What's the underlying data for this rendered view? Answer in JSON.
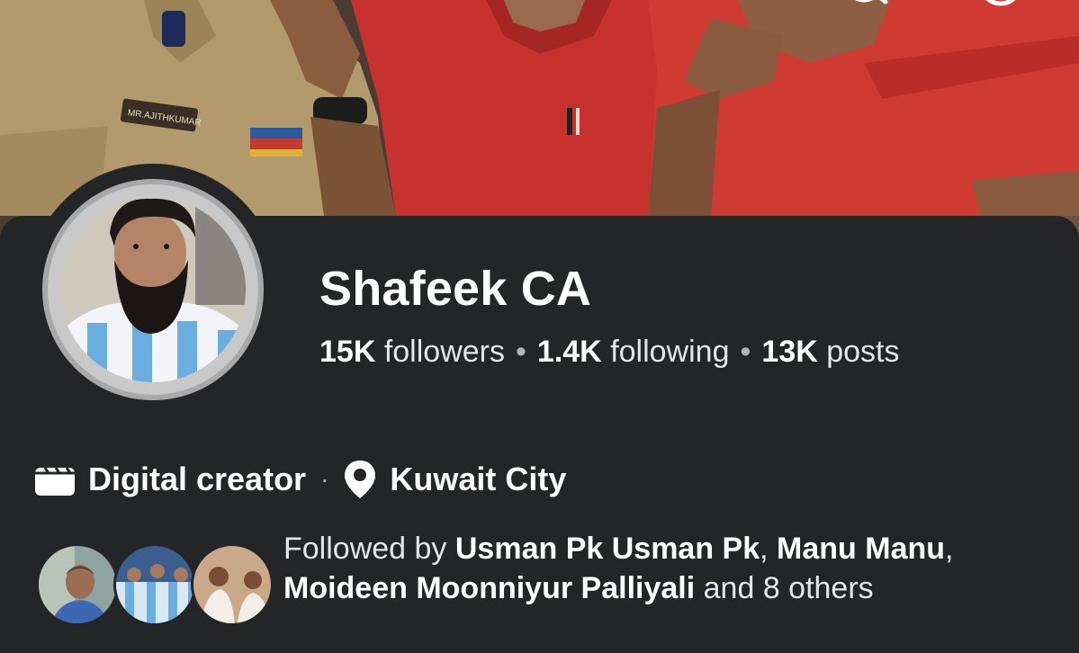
{
  "profile": {
    "name": "Shafeek CA",
    "followers_count": "15K",
    "followers_label": "followers",
    "following_count": "1.4K",
    "following_label": "following",
    "posts_count": "13K",
    "posts_label": "posts",
    "separator": "•"
  },
  "meta": {
    "category": "Digital creator",
    "location": "Kuwait City",
    "category_icon": "clapperboard-icon",
    "location_icon": "location-pin-icon"
  },
  "followed_by": {
    "prefix": "Followed by",
    "names": [
      "Usman Pk Usman Pk",
      "Manu Manu",
      "Moideen Moonniyur Palliyali"
    ],
    "suffix": "and 8 others"
  },
  "cover": {
    "name_tag": "MR.AJITHKUMAR"
  },
  "top_icons": [
    "back-arrow-icon",
    "search-icon",
    "more-icon"
  ],
  "colors": {
    "background": "#242526",
    "text_primary": "#ffffff",
    "text_secondary": "#e4e6eb",
    "shirt_red": "#c8322e",
    "uniform_khaki": "#b29a6c"
  }
}
